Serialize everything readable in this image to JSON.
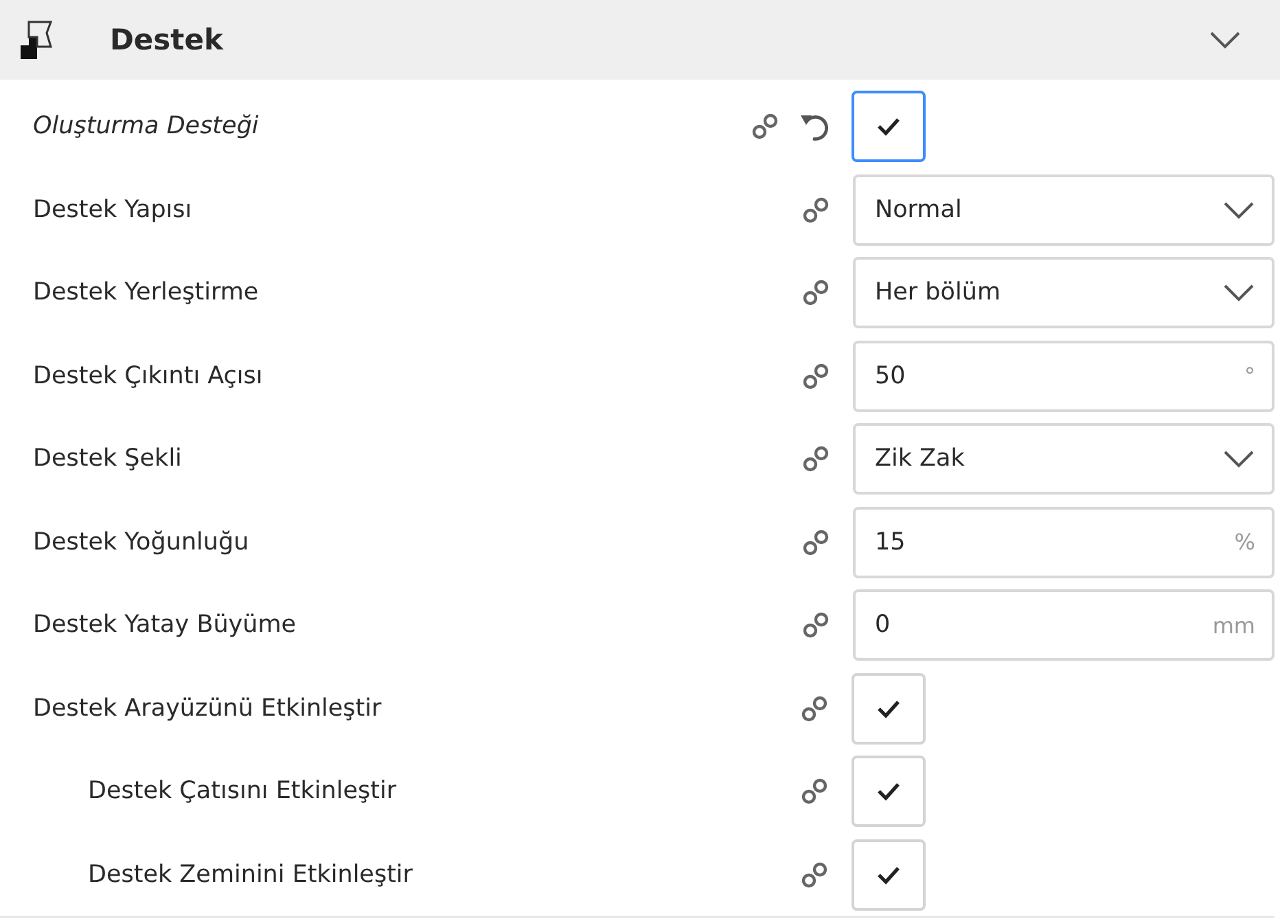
{
  "section": {
    "title": "Destek",
    "expanded": true
  },
  "settings": [
    {
      "kind": "checkbox",
      "label": "Oluşturma Desteği",
      "modified": true,
      "focused": true,
      "checked": true
    },
    {
      "kind": "dropdown",
      "label": "Destek Yapısı",
      "modified": false,
      "value": "Normal"
    },
    {
      "kind": "dropdown",
      "label": "Destek Yerleştirme",
      "modified": false,
      "value": "Her bölüm"
    },
    {
      "kind": "number",
      "label": "Destek Çıkıntı Açısı",
      "modified": false,
      "value": "50",
      "unit": "°"
    },
    {
      "kind": "dropdown",
      "label": "Destek Şekli",
      "modified": false,
      "value": "Zik Zak"
    },
    {
      "kind": "number",
      "label": "Destek Yoğunluğu",
      "modified": false,
      "value": "15",
      "unit": "%"
    },
    {
      "kind": "number",
      "label": "Destek Yatay Büyüme",
      "modified": false,
      "value": "0",
      "unit": "mm"
    },
    {
      "kind": "checkbox",
      "label": "Destek Arayüzünü Etkinleştir",
      "modified": false,
      "focused": false,
      "checked": true,
      "children": [
        {
          "kind": "checkbox",
          "label": "Destek Çatısını Etkinleştir",
          "modified": false,
          "focused": false,
          "checked": true
        },
        {
          "kind": "checkbox",
          "label": "Destek Zeminini Etkinleştir",
          "modified": false,
          "focused": false,
          "checked": true
        }
      ]
    }
  ]
}
